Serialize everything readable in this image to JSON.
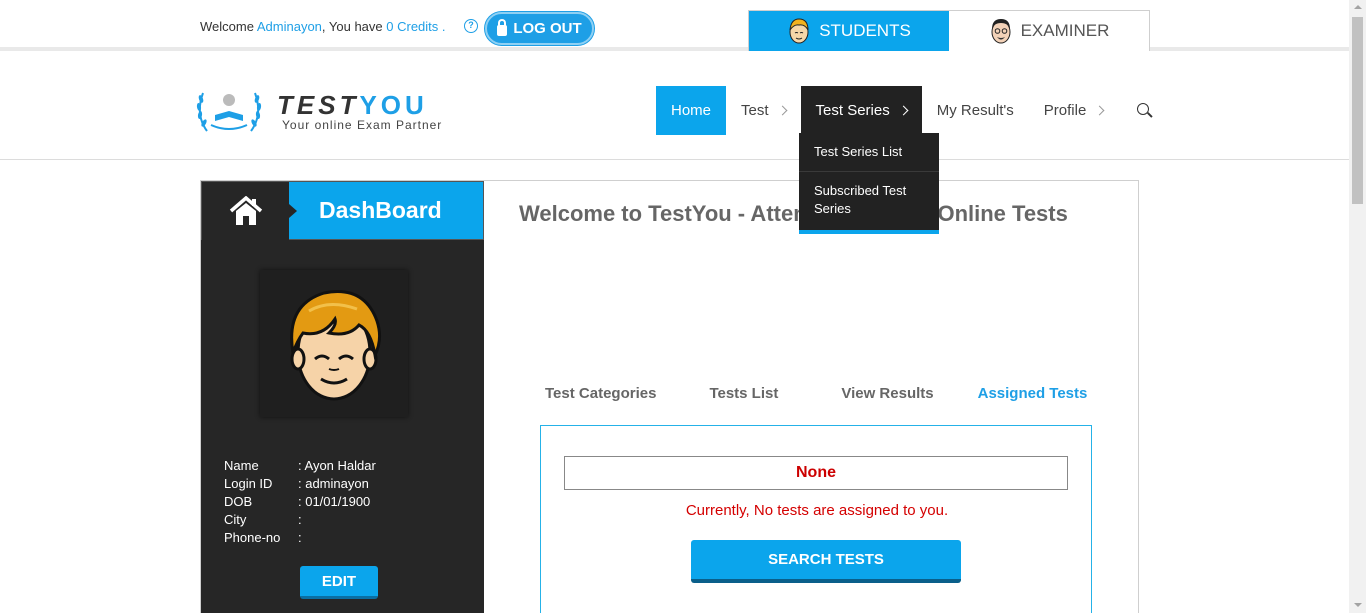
{
  "topbar": {
    "welcome_prefix": "Welcome",
    "username": "Adminayon",
    "credits_prefix": ", You have",
    "credits": "0 Credits",
    "credits_suffix": ".",
    "help_icon": "help-circle-icon",
    "logout_label": "LOG OUT",
    "roles": [
      {
        "label": "STUDENTS",
        "icon": "student-avatar-icon",
        "active": true
      },
      {
        "label": "EXAMINER",
        "icon": "examiner-avatar-icon",
        "active": false
      }
    ]
  },
  "brand": {
    "name_part1": "TEST",
    "name_part2": "YOU",
    "tagline": "Your online Exam Partner",
    "accent_color": "#0ba5ec"
  },
  "nav": {
    "items": [
      {
        "label": "Home"
      },
      {
        "label": "Test"
      },
      {
        "label": "Test Series"
      },
      {
        "label": "My Result's"
      },
      {
        "label": "Profile"
      }
    ],
    "search_icon": "search-icon",
    "dropdown": [
      "Test Series List",
      "Subscribed Test Series"
    ]
  },
  "sidebar": {
    "home_icon": "home-icon",
    "title": "DashBoard",
    "profile": [
      {
        "label": "Name",
        "value": ": Ayon Haldar"
      },
      {
        "label": "Login ID",
        "value": ": adminayon"
      },
      {
        "label": "DOB",
        "value": ": 01/01/1900"
      },
      {
        "label": "City",
        "value": ":"
      },
      {
        "label": "Phone-no",
        "value": ":"
      }
    ],
    "edit_label": "EDIT"
  },
  "main": {
    "welcome_title": "Welcome to TestYou - Attempt Free and Online Tests",
    "tabs": [
      "Test Categories",
      "Tests List",
      "View Results",
      "Assigned Tests"
    ],
    "active_tab": "Assigned Tests",
    "assigned_value": "None",
    "no_tests_message": "Currently, No tests are assigned to you.",
    "search_tests_label": "SEARCH TESTS"
  }
}
